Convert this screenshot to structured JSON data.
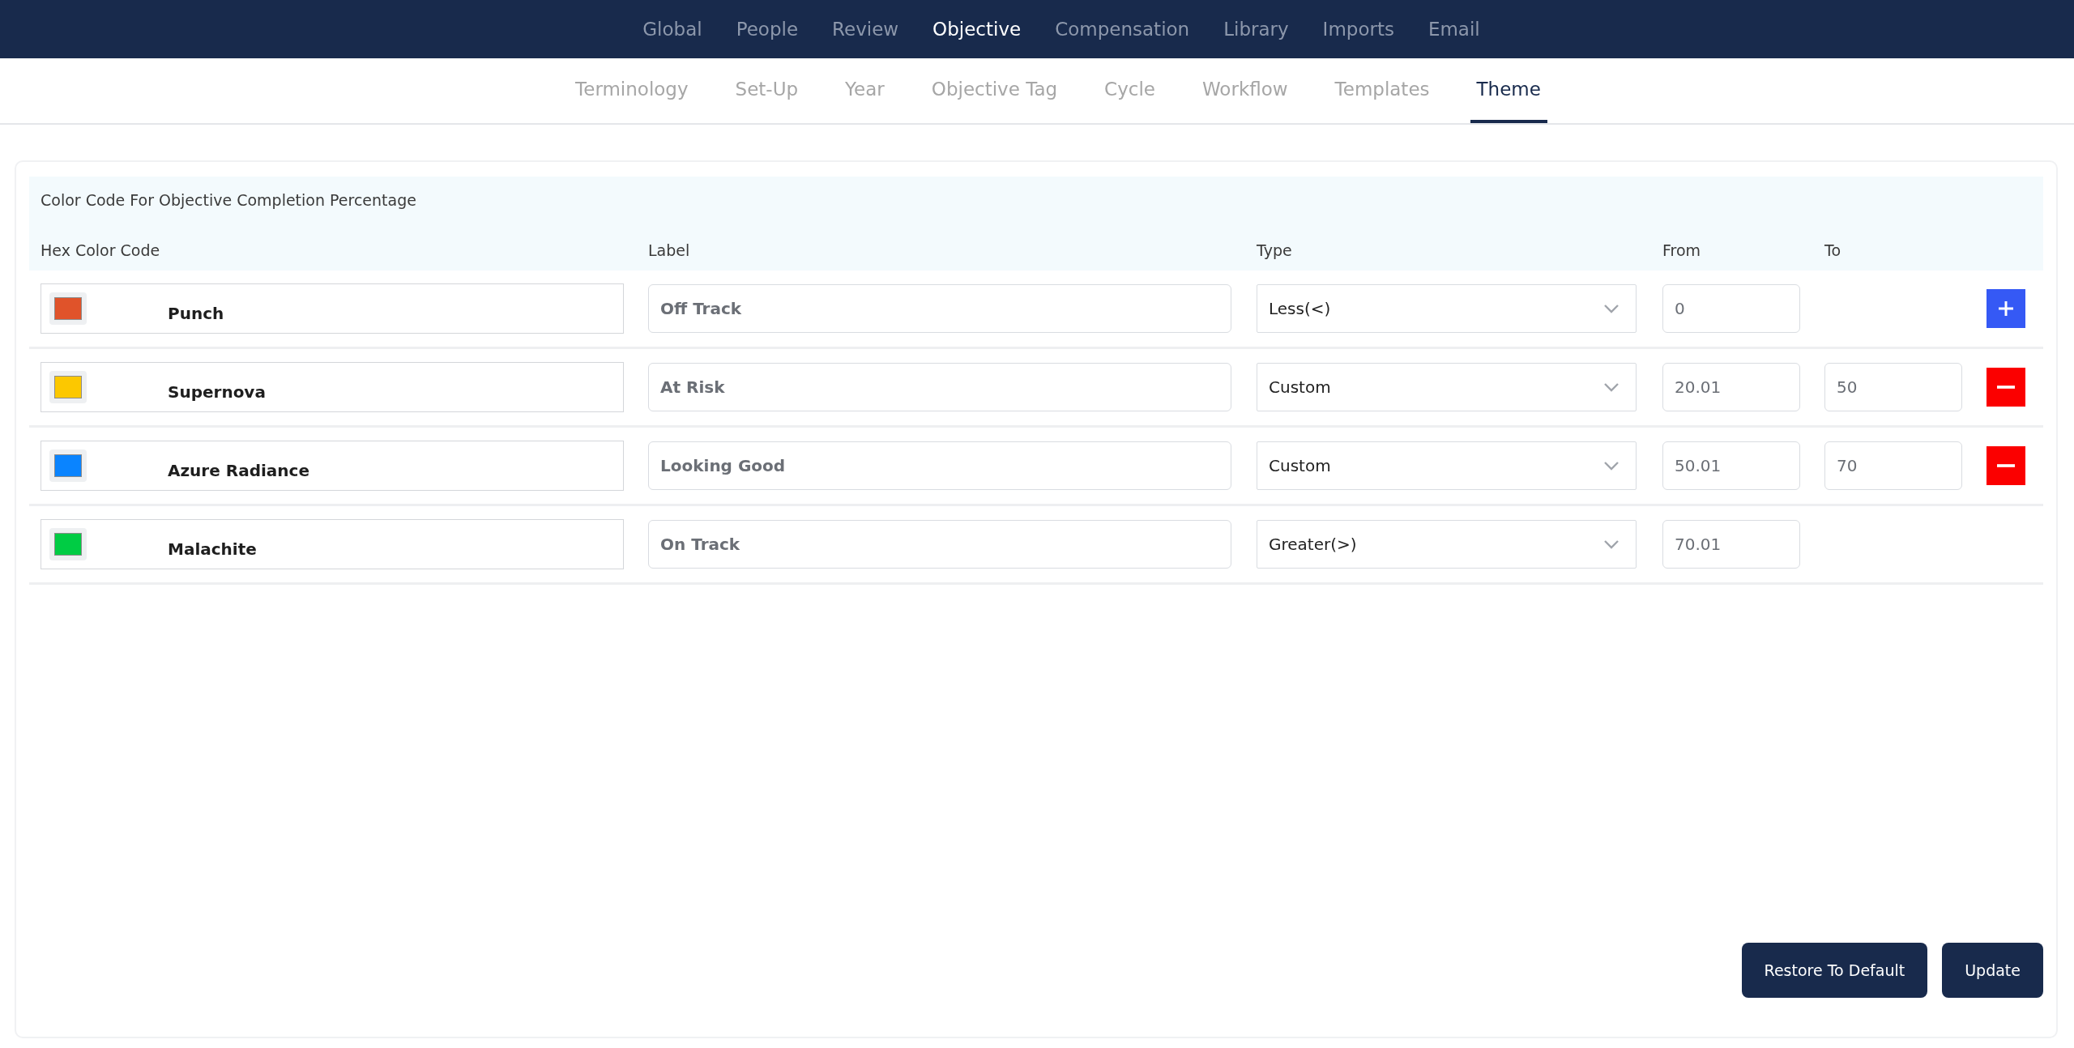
{
  "top_nav": [
    {
      "label": "Global",
      "selected": false
    },
    {
      "label": "People",
      "selected": false
    },
    {
      "label": "Review",
      "selected": false
    },
    {
      "label": "Objective",
      "selected": true
    },
    {
      "label": "Compensation",
      "selected": false
    },
    {
      "label": "Library",
      "selected": false
    },
    {
      "label": "Imports",
      "selected": false
    },
    {
      "label": "Email",
      "selected": false
    }
  ],
  "sub_nav": [
    {
      "label": "Terminology",
      "selected": false
    },
    {
      "label": "Set-Up",
      "selected": false
    },
    {
      "label": "Year",
      "selected": false
    },
    {
      "label": "Objective Tag",
      "selected": false
    },
    {
      "label": "Cycle",
      "selected": false
    },
    {
      "label": "Workflow",
      "selected": false
    },
    {
      "label": "Templates",
      "selected": false
    },
    {
      "label": "Theme",
      "selected": true
    }
  ],
  "section_title": "Color Code For Objective Completion Percentage",
  "columns": [
    "Hex Color Code",
    "Label",
    "Type",
    "From",
    "To"
  ],
  "rows": [
    {
      "color": "#e0532a",
      "color_name": "Punch",
      "label": "Off Track",
      "type": "Less(<)",
      "from": "0",
      "kind": "add"
    },
    {
      "color": "#fcc800",
      "color_name": "Supernova",
      "label": "At Risk",
      "type": "Custom",
      "from": "20.01",
      "to": "50",
      "kind": "remove"
    },
    {
      "color": "#0a84ff",
      "color_name": "Azure Radiance",
      "label": "Looking Good",
      "type": "Custom",
      "from": "50.01",
      "to": "70",
      "kind": "remove"
    },
    {
      "color": "#00cc44",
      "color_name": "Malachite",
      "label": "On Track",
      "type": "Greater(>)",
      "from": "70.01",
      "kind": "none"
    }
  ],
  "buttons": [
    "Restore To Default",
    "Update"
  ]
}
